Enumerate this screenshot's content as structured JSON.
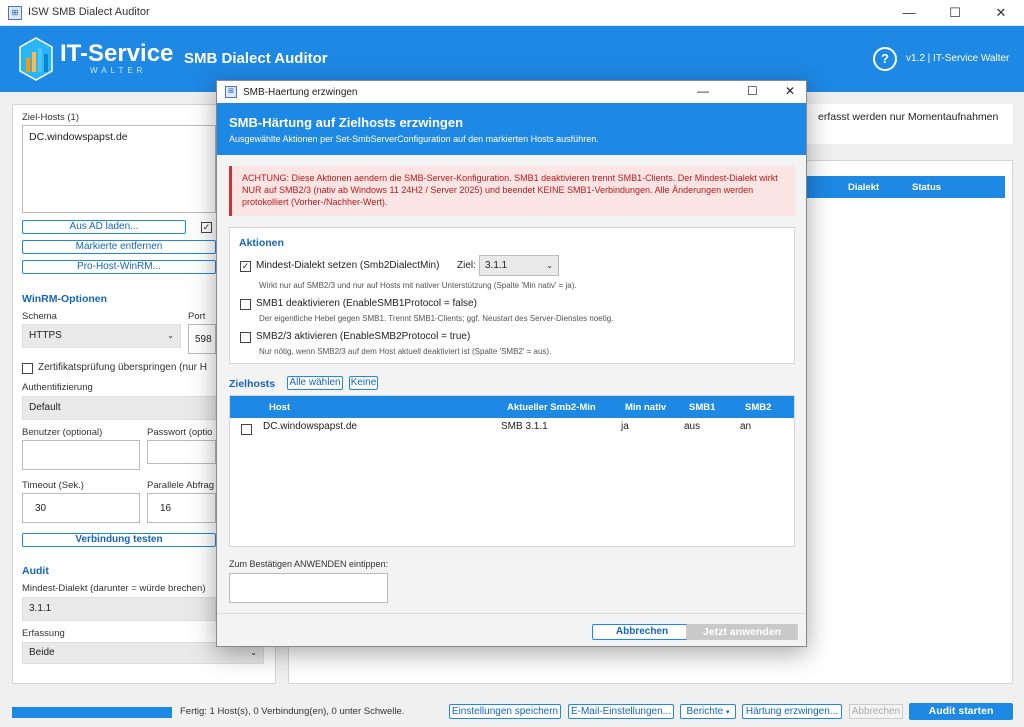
{
  "window": {
    "title": "ISW SMB Dialect Auditor"
  },
  "header": {
    "logo_text": "IT-Service",
    "logo_sub": "WALTER",
    "app_title": "SMB Dialect Auditor",
    "help": "?",
    "version": "v1.2  |  IT-Service Walter"
  },
  "left": {
    "hosts_label": "Ziel-Hosts (1)",
    "hosts_value": "DC.windowspapst.de",
    "btn_ad": "Aus AD laden...",
    "btn_remove": "Markierte entfernen",
    "btn_winrm": "Pro-Host-WinRM...",
    "winrm_title": "WinRM-Optionen",
    "schema_label": "Schema",
    "schema_value": "HTTPS",
    "port_label": "Port",
    "port_value": "598",
    "cert_skip": "Zertifikatsprüfung überspringen (nur H",
    "auth_label": "Authentifizierung",
    "auth_value": "Default",
    "user_label": "Benutzer (optional)",
    "pw_label": "Passwort (optio",
    "timeout_label": "Timeout (Sek.)",
    "timeout_value": "30",
    "parallel_label": "Parallele Abfrag",
    "parallel_value": "16",
    "btn_test": "Verbindung testen",
    "audit_title": "Audit",
    "min_dialect_label": "Mindest-Dialekt (darunter = würde brechen)",
    "min_dialect_value": "3.1.1",
    "capture_label": "Erfassung",
    "capture_value": "Beide"
  },
  "right": {
    "info_text": "erfasst werden nur Momentaufnahmen",
    "col_dialect": "Dialekt",
    "col_status": "Status"
  },
  "status": {
    "progress": 1.0,
    "text": "Fertig: 1 Host(s), 0 Verbindung(en), 0 unter Schwelle.",
    "btn_save": "Einstellungen speichern",
    "btn_mail": "E-Mail-Einstellungen...",
    "btn_reports": "Berichte",
    "btn_harden": "Härtung erzwingen...",
    "btn_cancel": "Abbrechen",
    "btn_start": "Audit starten"
  },
  "dialog": {
    "title": "SMB-Haertung erzwingen",
    "head_title": "SMB-Härtung auf Zielhosts erzwingen",
    "head_sub": "Ausgewählte Aktionen per Set-SmbServerConfiguration auf den markierten Hosts ausführen.",
    "warning": "ACHTUNG: Diese Aktionen aendern die SMB-Server-Konfiguration. SMB1 deaktivieren trennt SMB1-Clients. Der Mindest-Dialekt wirkt NUR auf SMB2/3 (nativ ab Windows 11 24H2 / Server 2025) und beendet KEINE SMB1-Verbindungen. Alle Änderungen werden protokolliert (Vorher-/Nachher-Wert).",
    "actions_title": "Aktionen",
    "a1_label": "Mindest-Dialekt setzen (Smb2DialectMin)",
    "a1_target_label": "Ziel:",
    "a1_target_value": "3.1.1",
    "a1_hint": "Wirkt nur auf SMB2/3 und nur auf Hosts mit nativer Unterstützung (Spalte 'Min nativ' = ja).",
    "a2_label": "SMB1 deaktivieren (EnableSMB1Protocol = false)",
    "a2_hint": "Der eigentliche Hebel gegen SMB1. Trennt SMB1-Clients; ggf. Neustart des Server-Dienstes noetig.",
    "a3_label": "SMB2/3 aktivieren (EnableSMB2Protocol = true)",
    "a3_hint": "Nur nötig, wenn SMB2/3 auf dem Host aktuell deaktiviert ist (Spalte 'SMB2' = aus).",
    "targets_title": "Zielhosts",
    "btn_all": "Alle wählen",
    "btn_none": "Keine",
    "columns": [
      "Host",
      "Aktueller Smb2-Min",
      "Min nativ",
      "SMB1",
      "SMB2"
    ],
    "rows": [
      [
        "DC.windowspapst.de",
        "SMB 3.1.1",
        "ja",
        "aus",
        "an"
      ]
    ],
    "confirm_label": "Zum Bestätigen ANWENDEN eintippen:",
    "confirm_value": "",
    "btn_cancel": "Abbrechen",
    "btn_apply": "Jetzt anwenden"
  }
}
